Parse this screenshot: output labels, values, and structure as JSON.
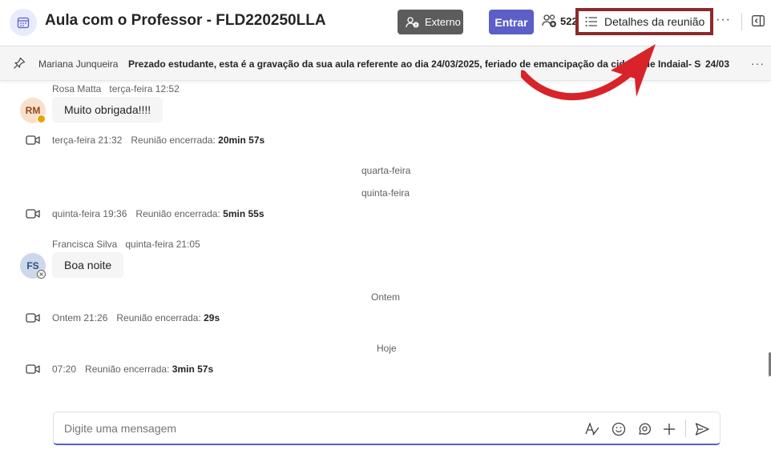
{
  "header": {
    "title": "Aula com o Professor - FLD220250LLA",
    "externo_label": "Externo",
    "entrar_label": "Entrar",
    "participant_count": "522",
    "details_label": "Detalhes da reunião",
    "more_label": "···"
  },
  "pinned": {
    "author": "Mariana Junqueira",
    "text": "Prezado estudante, esta é a gravação da sua aula referente ao dia 24/03/2025, feriado de emancipação da cidade de Indaial- SC. A...",
    "date": "24/03",
    "more_label": "···"
  },
  "messages": [
    {
      "author": "Rosa Matta",
      "time": "terça-feira 12:52",
      "initials": "RM",
      "text": "Muito obrigada!!!!"
    },
    {
      "author": "Francisca Silva",
      "time": "quinta-feira 21:05",
      "initials": "FS",
      "text": "Boa noite"
    }
  ],
  "events": [
    {
      "time": "terça-feira 21:32",
      "label": "Reunião encerrada:",
      "duration": "20min 57s"
    },
    {
      "time": "quinta-feira 19:36",
      "label": "Reunião encerrada:",
      "duration": "5min 55s"
    },
    {
      "time": "Ontem 21:26",
      "label": "Reunião encerrada:",
      "duration": "29s"
    },
    {
      "time": "07:20",
      "label": "Reunião encerrada:",
      "duration": "3min 57s"
    }
  ],
  "day_separators": [
    "quarta-feira",
    "quinta-feira",
    "Ontem",
    "Hoje"
  ],
  "composer": {
    "placeholder": "Digite uma mensagem"
  },
  "colors": {
    "accent": "#5b5fc7",
    "highlight_box": "#8b2a2a",
    "arrow": "#d8232a",
    "externo_bg": "#5c5c5c"
  },
  "icons": [
    "calendar-icon",
    "people-icon",
    "list-icon",
    "more-icon",
    "side-panel-icon",
    "pin-icon",
    "video-camera-icon",
    "format-icon",
    "emoji-icon",
    "loop-icon",
    "plus-icon",
    "send-icon"
  ]
}
